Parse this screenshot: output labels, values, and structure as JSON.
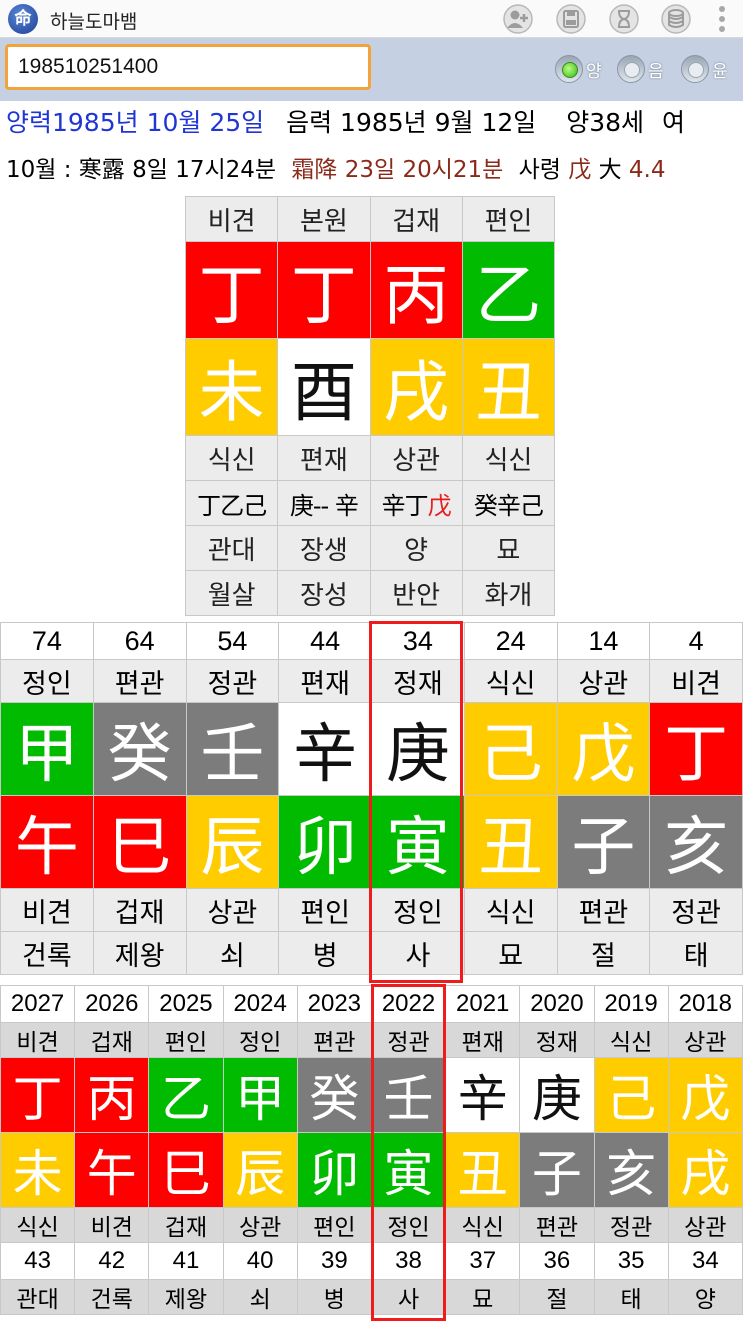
{
  "app": {
    "icon_char": "命",
    "title": "하늘도마뱀"
  },
  "toolbar": {
    "icons": [
      "add-person-icon",
      "save-icon",
      "hourglass-icon",
      "database-icon",
      "overflow-menu-icon"
    ]
  },
  "search": {
    "value": "198510251400",
    "radios": [
      {
        "label": "양",
        "selected": true
      },
      {
        "label": "음",
        "selected": false
      },
      {
        "label": "윤",
        "selected": false
      }
    ]
  },
  "info": {
    "solar": "양력1985년 10월 25일",
    "lunar": "음력 1985년 9월 12일",
    "age": "양38세",
    "gender": "여",
    "month": "10월 : 寒露 8일 17시24분",
    "term": "霜降 23일 20시21분",
    "saryeong_label": "사령",
    "saryeong_char": "戊",
    "dae_label": "大",
    "dae_value": "4.4"
  },
  "colors": {
    "red": "#ff0000",
    "green": "#00bb00",
    "yellow": "#ffcc00",
    "white": "#ffffff",
    "gray": "#7c7c7c",
    "highlight": "#ee1c1c",
    "blue_text": "#1f35d6"
  },
  "natal": {
    "ten_gods_top": [
      "비견",
      "본원",
      "겁재",
      "편인"
    ],
    "stems": [
      {
        "char": "丁",
        "color": "red"
      },
      {
        "char": "丁",
        "color": "red"
      },
      {
        "char": "丙",
        "color": "red"
      },
      {
        "char": "乙",
        "color": "green"
      }
    ],
    "branches": [
      {
        "char": "未",
        "color": "yellow"
      },
      {
        "char": "酉",
        "color": "white"
      },
      {
        "char": "戌",
        "color": "yellow"
      },
      {
        "char": "丑",
        "color": "yellow"
      }
    ],
    "ten_gods_bottom": [
      "식신",
      "편재",
      "상관",
      "식신"
    ],
    "hidden": [
      {
        "a": "丁乙己",
        "b": ""
      },
      {
        "a": "庚-- 辛",
        "b": ""
      },
      {
        "a": "辛丁",
        "b": "戊"
      },
      {
        "a": "癸辛己",
        "b": ""
      }
    ],
    "twelve_stages": [
      "관대",
      "장생",
      "양",
      "묘"
    ],
    "twelve_spirits": [
      "월살",
      "장성",
      "반안",
      "화개"
    ]
  },
  "daeun": {
    "ages": [
      "74",
      "64",
      "54",
      "44",
      "34",
      "24",
      "14",
      "4"
    ],
    "stem_gods": [
      "정인",
      "편관",
      "정관",
      "편재",
      "정재",
      "식신",
      "상관",
      "비견"
    ],
    "stems": [
      {
        "char": "甲",
        "color": "green"
      },
      {
        "char": "癸",
        "color": "gray"
      },
      {
        "char": "壬",
        "color": "gray"
      },
      {
        "char": "辛",
        "color": "white"
      },
      {
        "char": "庚",
        "color": "white"
      },
      {
        "char": "己",
        "color": "yellow"
      },
      {
        "char": "戊",
        "color": "yellow"
      },
      {
        "char": "丁",
        "color": "red"
      }
    ],
    "branches": [
      {
        "char": "午",
        "color": "red"
      },
      {
        "char": "巳",
        "color": "red"
      },
      {
        "char": "辰",
        "color": "yellow"
      },
      {
        "char": "卯",
        "color": "green"
      },
      {
        "char": "寅",
        "color": "green"
      },
      {
        "char": "丑",
        "color": "yellow"
      },
      {
        "char": "子",
        "color": "gray"
      },
      {
        "char": "亥",
        "color": "gray"
      }
    ],
    "branch_gods": [
      "비견",
      "겁재",
      "상관",
      "편인",
      "정인",
      "식신",
      "편관",
      "정관"
    ],
    "stages": [
      "건록",
      "제왕",
      "쇠",
      "병",
      "사",
      "묘",
      "절",
      "태"
    ],
    "selected_index": 4
  },
  "seun": {
    "years": [
      "2027",
      "2026",
      "2025",
      "2024",
      "2023",
      "2022",
      "2021",
      "2020",
      "2019",
      "2018"
    ],
    "stem_gods": [
      "비견",
      "겁재",
      "편인",
      "정인",
      "편관",
      "정관",
      "편재",
      "정재",
      "식신",
      "상관"
    ],
    "stems": [
      {
        "char": "丁",
        "color": "red"
      },
      {
        "char": "丙",
        "color": "red"
      },
      {
        "char": "乙",
        "color": "green"
      },
      {
        "char": "甲",
        "color": "green"
      },
      {
        "char": "癸",
        "color": "gray"
      },
      {
        "char": "壬",
        "color": "gray"
      },
      {
        "char": "辛",
        "color": "white"
      },
      {
        "char": "庚",
        "color": "white"
      },
      {
        "char": "己",
        "color": "yellow"
      },
      {
        "char": "戊",
        "color": "yellow"
      }
    ],
    "branches": [
      {
        "char": "未",
        "color": "yellow"
      },
      {
        "char": "午",
        "color": "red"
      },
      {
        "char": "巳",
        "color": "red"
      },
      {
        "char": "辰",
        "color": "yellow"
      },
      {
        "char": "卯",
        "color": "green"
      },
      {
        "char": "寅",
        "color": "green"
      },
      {
        "char": "丑",
        "color": "yellow"
      },
      {
        "char": "子",
        "color": "gray"
      },
      {
        "char": "亥",
        "color": "gray"
      },
      {
        "char": "戌",
        "color": "yellow"
      }
    ],
    "branch_gods": [
      "식신",
      "비견",
      "겁재",
      "상관",
      "편인",
      "정인",
      "식신",
      "편관",
      "정관",
      "상관"
    ],
    "ages": [
      "43",
      "42",
      "41",
      "40",
      "39",
      "38",
      "37",
      "36",
      "35",
      "34"
    ],
    "stages": [
      "관대",
      "건록",
      "제왕",
      "쇠",
      "병",
      "사",
      "묘",
      "절",
      "태",
      "양"
    ],
    "selected_index": 5
  }
}
